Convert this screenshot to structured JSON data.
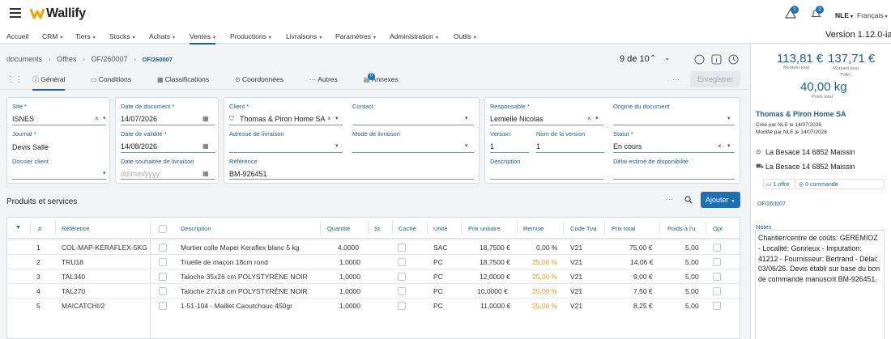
{
  "app": {
    "logo": "Wallify"
  },
  "header": {
    "alerts_count": "1",
    "notifications_count": "2",
    "user": "NLE",
    "language": "Français",
    "version": "Version 1.12.0-ia.5"
  },
  "menu": [
    "Accueil",
    "CRM",
    "Tiers",
    "Stocks",
    "Achats",
    "Ventes",
    "Productions",
    "Livraisons",
    "Paramètres",
    "Administration",
    "Outils"
  ],
  "breadcrumb": {
    "documents": "documents",
    "offres": "Offres",
    "id": "OF/260007",
    "current": "OF/260007"
  },
  "pager": {
    "text": "9 de 10"
  },
  "tabs": {
    "general": "Général",
    "conditions": "Conditions",
    "classifications": "Classifications",
    "coordonnees": "Coordonnées",
    "autres": "Autres",
    "annexes": "Annexes",
    "annexes_count": "0",
    "save": "Enregistrer"
  },
  "form": {
    "site_label": "Site",
    "site_value": "ISNES",
    "journal_label": "Journal",
    "journal_value": "Devis Salle",
    "dossier_label": "Dossier client",
    "date_doc_label": "Date de document",
    "date_doc_value": "14/07/2026",
    "date_valid_label": "Date de validité",
    "date_valid_value": "14/08/2026",
    "date_livr_label": "Date souhaitée de livraison",
    "date_livr_placeholder": "dd/mm/yyyy",
    "client_label": "Client",
    "client_value": "Thomas & Piron Home SA",
    "contact_label": "Contact",
    "adresse_label": "Adresse de livraison",
    "mode_label": "Mode de livraison",
    "reference_label": "Référence",
    "reference_value": "BM-926451",
    "responsable_label": "Responsable",
    "responsable_value": "Lemielle Nicolas",
    "origine_label": "Origine du document",
    "version_label": "Version",
    "version_value": "1",
    "nom_version_label": "Nom de la version",
    "nom_version_value": "1",
    "statut_label": "Statut",
    "statut_value": "En cours",
    "description_label": "Description",
    "delai_label": "Délai estimé de disponibilité"
  },
  "products": {
    "title": "Produits et services",
    "add_button": "Ajouter",
    "columns": [
      "#",
      "Référence",
      "Description",
      "Quantité",
      "St",
      "Caché",
      "Unité",
      "Prix unitaire",
      "Remise",
      "Code Tva",
      "Prix total",
      "Poids à l'u",
      "Opt"
    ],
    "rows": [
      {
        "n": "1",
        "ref": "COL-MAP-KERAFLEX-5KG",
        "desc": "Mortier colle Mapei Keraflex blanc 5 kg",
        "qty": "4,0000",
        "unit": "SAC",
        "pu": "18,7500 €",
        "remise": "0,00 %",
        "tva": "V21",
        "total": "75,00 €",
        "poids": "5,00"
      },
      {
        "n": "2",
        "ref": "TRU18",
        "desc": "Truelle de maçon 18cm rond",
        "qty": "1,0000",
        "unit": "PC",
        "pu": "18,7500 €",
        "remise": "25,00 %",
        "tva": "V21",
        "total": "14,06 €",
        "poids": "5,00"
      },
      {
        "n": "3",
        "ref": "TAL340",
        "desc": "Taloche 35x26 cm POLYSTYRÈNE NOIR",
        "qty": "1,0000",
        "unit": "PC",
        "pu": "12,0000 €",
        "remise": "25,00 %",
        "tva": "V21",
        "total": "9,00 €",
        "poids": "5,00"
      },
      {
        "n": "4",
        "ref": "TAL270",
        "desc": "Taloche 27x18 cm POLYSTYRÈNE NOIR",
        "qty": "1,0000",
        "unit": "PC",
        "pu": "10,0000 €",
        "remise": "25,00 %",
        "tva": "V21",
        "total": "7,50 €",
        "poids": "5,00"
      },
      {
        "n": "5",
        "ref": "MAICATCHI/2",
        "desc": "1-51-104 - Maillet Caoutchouc 450gr",
        "qty": "1,0000",
        "unit": "PC",
        "pu": "11,0000 €",
        "remise": "25,00 %",
        "tva": "V21",
        "total": "8,25 €",
        "poids": "5,00"
      }
    ]
  },
  "sidebar": {
    "total_ht": "113,81 €",
    "total_ht_label": "Montant total",
    "total_ttc": "137,71 €",
    "total_ttc_label": "Montant total TVAC",
    "weight": "40,00 kg",
    "weight_label": "Poids total",
    "company": "Thomas & Piron Home SA",
    "created": "Créé par NLE le 14/07/2026",
    "modified": "Modifié par NLE le 14/07/2026",
    "address1": "La Besace 14 6852 Maissin",
    "address2": "La Besace 14 6852 Maissin",
    "offres": "1 offre",
    "commandes": "0 commande",
    "doc_ref": "OF/260007",
    "notes_label": "Notes",
    "notes_text": "Chantier/centre de coûts: GEREMIOZ - Localité: Gonrieux - Imputation: 41212 - Fournisseur: Bertrand - Délai: 03/06/26. Devis établi sur base du bon de commande manuscrit BM-926451."
  },
  "colors": {
    "accent": "#1e5f96",
    "button": "#1e6fb3",
    "orange": "#f0a020"
  }
}
